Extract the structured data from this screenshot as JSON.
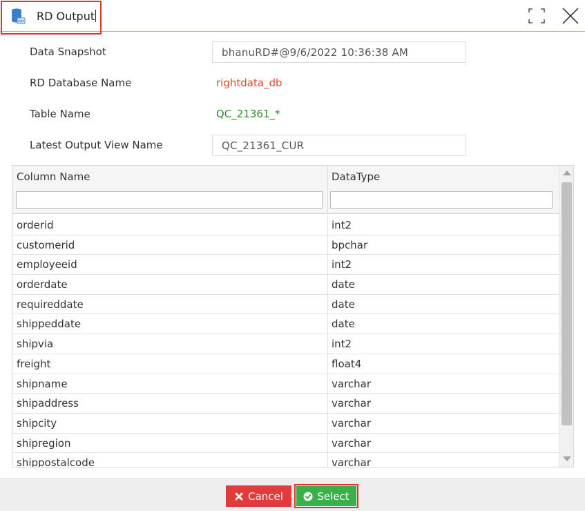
{
  "window": {
    "title": "RD Output",
    "icon": "database-icon"
  },
  "form": {
    "data_snapshot_label": "Data Snapshot",
    "data_snapshot_value": "bhanuRD#@9/6/2022 10:36:38 AM",
    "db_name_label": "RD Database Name",
    "db_name_value": "rightdata_db",
    "table_name_label": "Table Name",
    "table_name_value": "QC_21361_*",
    "view_name_label": "Latest Output View Name",
    "view_name_value": "QC_21361_CUR"
  },
  "grid": {
    "columns": [
      "Column Name",
      "DataType"
    ],
    "rows": [
      [
        "orderid",
        "int2"
      ],
      [
        "customerid",
        "bpchar"
      ],
      [
        "employeeid",
        "int2"
      ],
      [
        "orderdate",
        "date"
      ],
      [
        "requireddate",
        "date"
      ],
      [
        "shippeddate",
        "date"
      ],
      [
        "shipvia",
        "int2"
      ],
      [
        "freight",
        "float4"
      ],
      [
        "shipname",
        "varchar"
      ],
      [
        "shipaddress",
        "varchar"
      ],
      [
        "shipcity",
        "varchar"
      ],
      [
        "shipregion",
        "varchar"
      ],
      [
        "shippostalcode",
        "varchar"
      ]
    ]
  },
  "footer": {
    "cancel_label": "Cancel",
    "select_label": "Select"
  },
  "colors": {
    "db_name": "#e04a2f",
    "table_name": "#2e8b2e",
    "cancel": "#e23b3b",
    "select": "#3bb04a",
    "highlight": "#e0342c"
  }
}
